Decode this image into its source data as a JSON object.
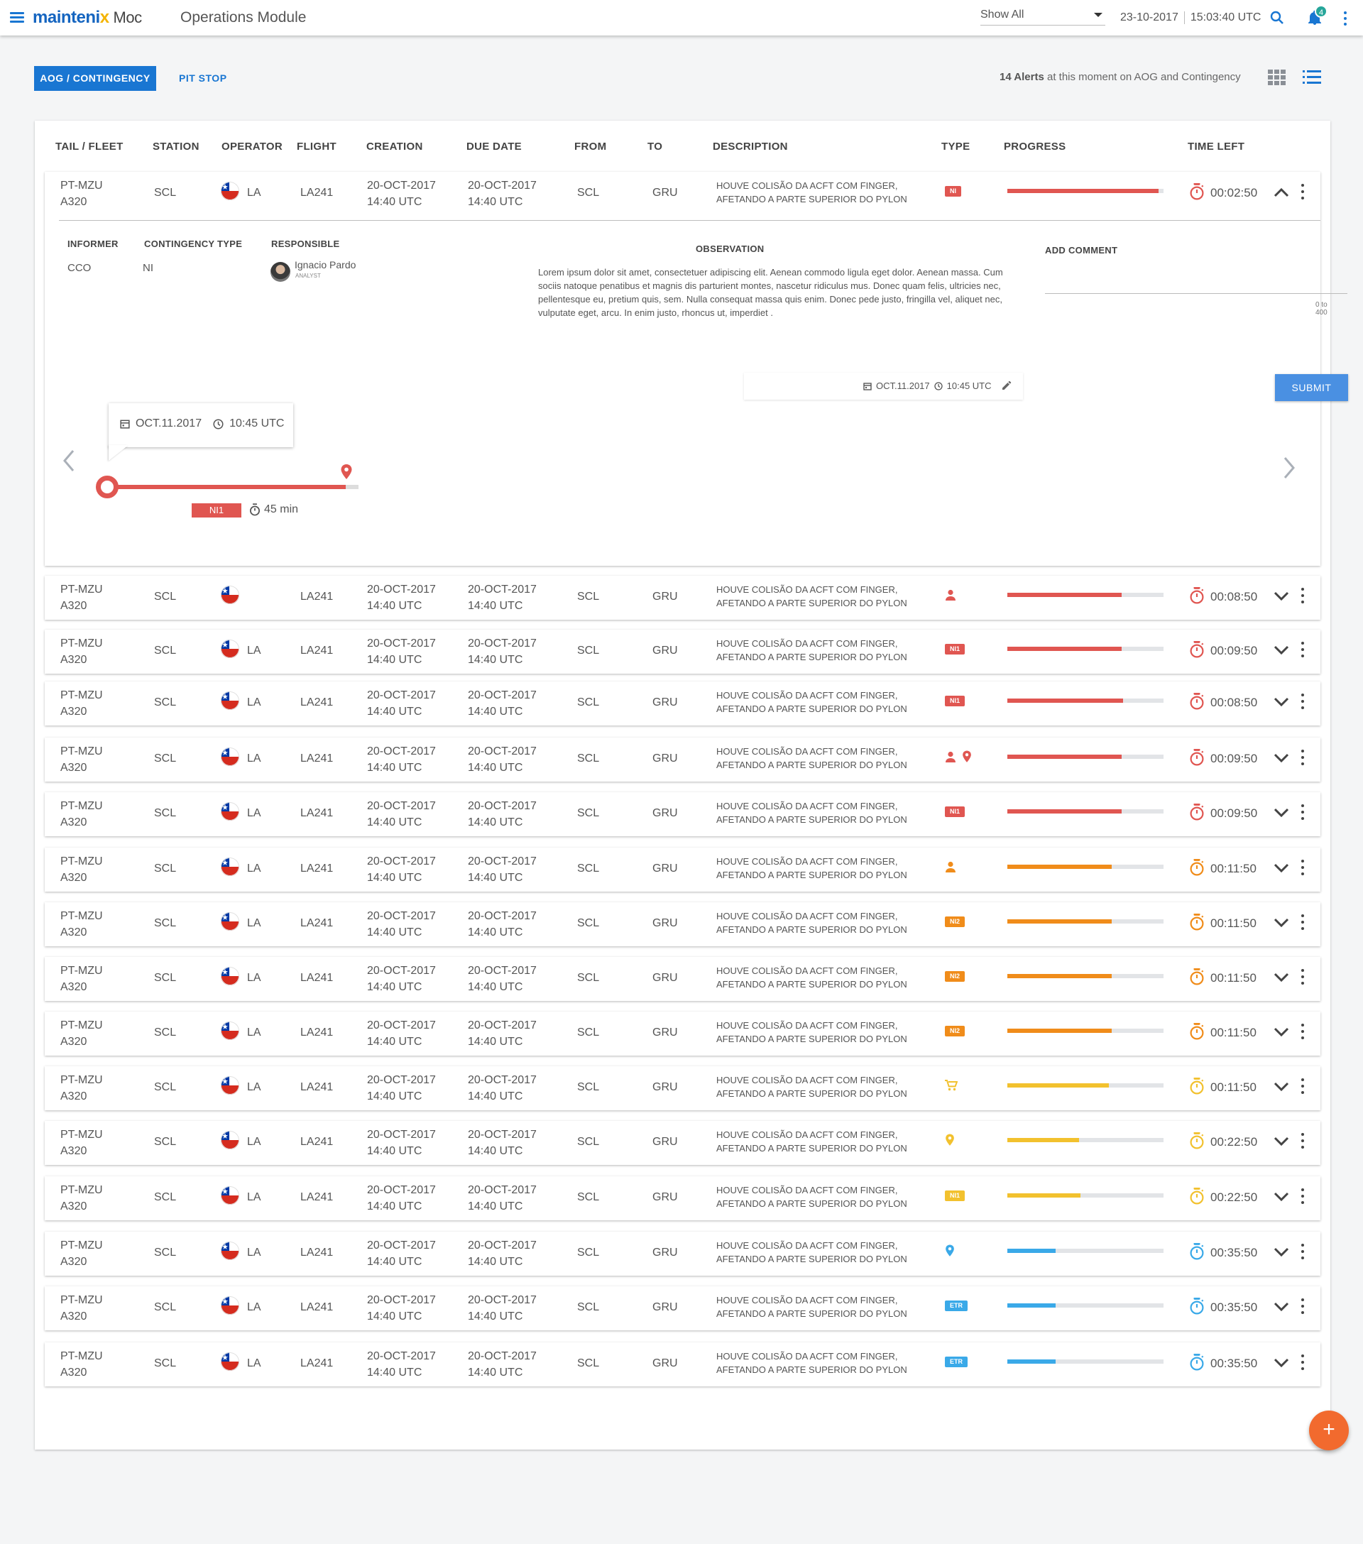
{
  "header": {
    "logo_main": "mainteni",
    "logo_x": "x",
    "logo_sub": "Moc",
    "module_title": "Operations Module",
    "filter_value": "Show All",
    "date": "23-10-2017",
    "time": "15:03:40 UTC",
    "notification_count": "4"
  },
  "tabs": {
    "aog": "AOG / CONTINGENCY",
    "pitstop": "PIT STOP"
  },
  "alerts": {
    "count_text": "14 Alerts",
    "suffix": " at this moment on AOG and Contingency"
  },
  "columns": {
    "tail": "TAIL / FLEET",
    "station": "STATION",
    "operator": "OPERATOR",
    "flight": "FLIGHT",
    "creation": "CREATION",
    "due": "DUE DATE",
    "from": "FROM",
    "to": "TO",
    "description": "DESCRIPTION",
    "type": "TYPE",
    "progress": "PROGRESS",
    "time_left": "TIME LEFT"
  },
  "colors": {
    "red": "#e05651",
    "orange": "#f08c1a",
    "yellow": "#f2c12e",
    "blue": "#3aa9e8",
    "accent": "#1976d2"
  },
  "detail": {
    "labels": {
      "informer": "INFORMER",
      "contingency_type": "CONTINGENCY TYPE",
      "responsible": "RESPONSIBLE",
      "observation": "OBSERVATION",
      "add_comment": "ADD COMMENT"
    },
    "informer": "CCO",
    "contingency_type": "NI",
    "responsible_name": "Ignacio Pardo",
    "responsible_role": "ANALYST",
    "observation": "Lorem ipsum dolor sit amet, consectetuer adipiscing elit. Aenean commodo ligula eget dolor. Aenean massa. Cum sociis natoque penatibus et magnis dis parturient montes, nascetur ridiculus mus. Donec quam felis, ultricies nec, pellentesque eu, pretium quis, sem. Nulla consequat massa quis enim. Donec pede justo, fringilla vel, aliquet nec, vulputate eget, arcu. In enim justo, rhoncus ut, imperdiet .",
    "comment_counter": "0 to 400",
    "submit": "SUBMIT",
    "stamp_date": "OCT.11.2017",
    "stamp_time": "10:45 UTC",
    "tooltip_date": "OCT.11.2017",
    "tooltip_time": "10:45 UTC",
    "timeline_badge": "NI1",
    "timeline_duration": "45 min",
    "timeline_progress": 0.95
  },
  "rows": [
    {
      "tail": "PT-MZU",
      "fleet": "A320",
      "station": "SCL",
      "op": "LA",
      "flight": "LA241",
      "c_date": "20-OCT-2017",
      "c_time": "14:40 UTC",
      "d_date": "20-OCT-2017",
      "d_time": "14:40 UTC",
      "from": "SCL",
      "to": "GRU",
      "desc1": "HOUVE COLISÃO DA ACFT COM FINGER,",
      "desc2": "AFETANDO A PARTE SUPERIOR DO PYLON",
      "type": [
        "badge:NI"
      ],
      "progress": 0.97,
      "color": "red",
      "time_left": "00:02:50",
      "expanded": true
    },
    {
      "tail": "PT-MZU",
      "fleet": "A320",
      "station": "SCL",
      "op": "",
      "flight": "LA241",
      "c_date": "20-OCT-2017",
      "c_time": "14:40 UTC",
      "d_date": "20-OCT-2017",
      "d_time": "14:40 UTC",
      "from": "SCL",
      "to": "GRU",
      "desc1": "HOUVE COLISÃO DA ACFT COM FINGER,",
      "desc2": "AFETANDO A PARTE SUPERIOR DO PYLON",
      "type": [
        "person"
      ],
      "progress": 0.73,
      "color": "red",
      "time_left": "00:08:50"
    },
    {
      "tail": "PT-MZU",
      "fleet": "A320",
      "station": "SCL",
      "op": "LA",
      "flight": "LA241",
      "c_date": "20-OCT-2017",
      "c_time": "14:40 UTC",
      "d_date": "20-OCT-2017",
      "d_time": "14:40 UTC",
      "from": "SCL",
      "to": "GRU",
      "desc1": "HOUVE COLISÃO DA ACFT COM FINGER,",
      "desc2": "AFETANDO A PARTE SUPERIOR DO PYLON",
      "type": [
        "badge:NI1"
      ],
      "progress": 0.73,
      "color": "red",
      "time_left": "00:09:50"
    },
    {
      "tail": "PT-MZU",
      "fleet": "A320",
      "station": "SCL",
      "op": "LA",
      "flight": "LA241",
      "c_date": "20-OCT-2017",
      "c_time": "14:40 UTC",
      "d_date": "20-OCT-2017",
      "d_time": "14:40 UTC",
      "from": "SCL",
      "to": "GRU",
      "desc1": "HOUVE COLISÃO DA ACFT COM FINGER,",
      "desc2": "AFETANDO A PARTE SUPERIOR DO PYLON",
      "type": [
        "badge:NI1"
      ],
      "progress": 0.74,
      "color": "red",
      "time_left": "00:08:50"
    },
    {
      "tail": "PT-MZU",
      "fleet": "A320",
      "station": "SCL",
      "op": "LA",
      "flight": "LA241",
      "c_date": "20-OCT-2017",
      "c_time": "14:40 UTC",
      "d_date": "20-OCT-2017",
      "d_time": "14:40 UTC",
      "from": "SCL",
      "to": "GRU",
      "desc1": "HOUVE COLISÃO DA ACFT COM FINGER,",
      "desc2": "AFETANDO A PARTE SUPERIOR DO PYLON",
      "type": [
        "person",
        "pin"
      ],
      "progress": 0.73,
      "color": "red",
      "time_left": "00:09:50"
    },
    {
      "tail": "PT-MZU",
      "fleet": "A320",
      "station": "SCL",
      "op": "LA",
      "flight": "LA241",
      "c_date": "20-OCT-2017",
      "c_time": "14:40 UTC",
      "d_date": "20-OCT-2017",
      "d_time": "14:40 UTC",
      "from": "SCL",
      "to": "GRU",
      "desc1": "HOUVE COLISÃO DA ACFT COM FINGER,",
      "desc2": "AFETANDO A PARTE SUPERIOR DO PYLON",
      "type": [
        "badge:NI1"
      ],
      "progress": 0.73,
      "color": "red",
      "time_left": "00:09:50"
    },
    {
      "tail": "PT-MZU",
      "fleet": "A320",
      "station": "SCL",
      "op": "LA",
      "flight": "LA241",
      "c_date": "20-OCT-2017",
      "c_time": "14:40 UTC",
      "d_date": "20-OCT-2017",
      "d_time": "14:40 UTC",
      "from": "SCL",
      "to": "GRU",
      "desc1": "HOUVE COLISÃO DA ACFT COM FINGER,",
      "desc2": "AFETANDO A PARTE SUPERIOR DO PYLON",
      "type": [
        "person"
      ],
      "progress": 0.67,
      "color": "orange",
      "time_left": "00:11:50"
    },
    {
      "tail": "PT-MZU",
      "fleet": "A320",
      "station": "SCL",
      "op": "LA",
      "flight": "LA241",
      "c_date": "20-OCT-2017",
      "c_time": "14:40 UTC",
      "d_date": "20-OCT-2017",
      "d_time": "14:40 UTC",
      "from": "SCL",
      "to": "GRU",
      "desc1": "HOUVE COLISÃO DA ACFT COM FINGER,",
      "desc2": "AFETANDO A PARTE SUPERIOR DO PYLON",
      "type": [
        "badge:NI2"
      ],
      "progress": 0.67,
      "color": "orange",
      "time_left": "00:11:50"
    },
    {
      "tail": "PT-MZU",
      "fleet": "A320",
      "station": "SCL",
      "op": "LA",
      "flight": "LA241",
      "c_date": "20-OCT-2017",
      "c_time": "14:40 UTC",
      "d_date": "20-OCT-2017",
      "d_time": "14:40 UTC",
      "from": "SCL",
      "to": "GRU",
      "desc1": "HOUVE COLISÃO DA ACFT COM FINGER,",
      "desc2": "AFETANDO A PARTE SUPERIOR DO PYLON",
      "type": [
        "badge:NI2"
      ],
      "progress": 0.67,
      "color": "orange",
      "time_left": "00:11:50"
    },
    {
      "tail": "PT-MZU",
      "fleet": "A320",
      "station": "SCL",
      "op": "LA",
      "flight": "LA241",
      "c_date": "20-OCT-2017",
      "c_time": "14:40 UTC",
      "d_date": "20-OCT-2017",
      "d_time": "14:40 UTC",
      "from": "SCL",
      "to": "GRU",
      "desc1": "HOUVE COLISÃO DA ACFT COM FINGER,",
      "desc2": "AFETANDO A PARTE SUPERIOR DO PYLON",
      "type": [
        "badge:NI2"
      ],
      "progress": 0.67,
      "color": "orange",
      "time_left": "00:11:50"
    },
    {
      "tail": "PT-MZU",
      "fleet": "A320",
      "station": "SCL",
      "op": "LA",
      "flight": "LA241",
      "c_date": "20-OCT-2017",
      "c_time": "14:40 UTC",
      "d_date": "20-OCT-2017",
      "d_time": "14:40 UTC",
      "from": "SCL",
      "to": "GRU",
      "desc1": "HOUVE COLISÃO DA ACFT COM FINGER,",
      "desc2": "AFETANDO A PARTE SUPERIOR DO PYLON",
      "type": [
        "cart"
      ],
      "progress": 0.65,
      "color": "yellow",
      "time_left": "00:11:50"
    },
    {
      "tail": "PT-MZU",
      "fleet": "A320",
      "station": "SCL",
      "op": "LA",
      "flight": "LA241",
      "c_date": "20-OCT-2017",
      "c_time": "14:40 UTC",
      "d_date": "20-OCT-2017",
      "d_time": "14:40 UTC",
      "from": "SCL",
      "to": "GRU",
      "desc1": "HOUVE COLISÃO DA ACFT COM FINGER,",
      "desc2": "AFETANDO A PARTE SUPERIOR DO PYLON",
      "type": [
        "pin"
      ],
      "progress": 0.46,
      "color": "yellow",
      "time_left": "00:22:50"
    },
    {
      "tail": "PT-MZU",
      "fleet": "A320",
      "station": "SCL",
      "op": "LA",
      "flight": "LA241",
      "c_date": "20-OCT-2017",
      "c_time": "14:40 UTC",
      "d_date": "20-OCT-2017",
      "d_time": "14:40 UTC",
      "from": "SCL",
      "to": "GRU",
      "desc1": "HOUVE COLISÃO DA ACFT COM FINGER,",
      "desc2": "AFETANDO A PARTE SUPERIOR DO PYLON",
      "type": [
        "badge:NI1"
      ],
      "progress": 0.47,
      "color": "yellow",
      "time_left": "00:22:50"
    },
    {
      "tail": "PT-MZU",
      "fleet": "A320",
      "station": "SCL",
      "op": "LA",
      "flight": "LA241",
      "c_date": "20-OCT-2017",
      "c_time": "14:40 UTC",
      "d_date": "20-OCT-2017",
      "d_time": "14:40 UTC",
      "from": "SCL",
      "to": "GRU",
      "desc1": "HOUVE COLISÃO DA ACFT COM FINGER,",
      "desc2": "AFETANDO A PARTE SUPERIOR DO PYLON",
      "type": [
        "pin"
      ],
      "progress": 0.31,
      "color": "blue",
      "time_left": "00:35:50"
    },
    {
      "tail": "PT-MZU",
      "fleet": "A320",
      "station": "SCL",
      "op": "LA",
      "flight": "LA241",
      "c_date": "20-OCT-2017",
      "c_time": "14:40 UTC",
      "d_date": "20-OCT-2017",
      "d_time": "14:40 UTC",
      "from": "SCL",
      "to": "GRU",
      "desc1": "HOUVE COLISÃO DA ACFT COM FINGER,",
      "desc2": "AFETANDO A PARTE SUPERIOR DO PYLON",
      "type": [
        "badge:ETR"
      ],
      "progress": 0.31,
      "color": "blue",
      "time_left": "00:35:50"
    },
    {
      "tail": "PT-MZU",
      "fleet": "A320",
      "station": "SCL",
      "op": "LA",
      "flight": "LA241",
      "c_date": "20-OCT-2017",
      "c_time": "14:40 UTC",
      "d_date": "20-OCT-2017",
      "d_time": "14:40 UTC",
      "from": "SCL",
      "to": "GRU",
      "desc1": "HOUVE COLISÃO DA ACFT COM FINGER,",
      "desc2": "AFETANDO A PARTE SUPERIOR DO PYLON",
      "type": [
        "badge:ETR"
      ],
      "progress": 0.31,
      "color": "blue",
      "time_left": "00:35:50"
    }
  ]
}
